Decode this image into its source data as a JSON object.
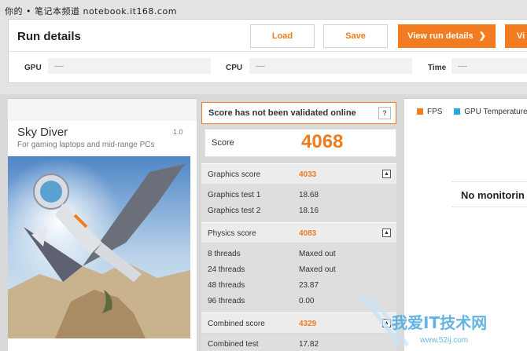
{
  "watermark_top": "你的 • 笔记本频道 notebook.it168.com",
  "run": {
    "title": "Run details",
    "load_label": "Load",
    "save_label": "Save",
    "view_label": "View run details",
    "view_arrow": "❯",
    "view2_label": "Vi",
    "gpu_label": "GPU",
    "gpu_value": "----",
    "cpu_label": "CPU",
    "cpu_value": "----",
    "time_label": "Time",
    "time_value": "----"
  },
  "test": {
    "title": "Sky Diver",
    "version": "1.0",
    "subtitle": "For gaming laptops and mid-range PCs"
  },
  "score": {
    "validation_text": "Score has not been validated online",
    "help": "?",
    "label": "Score",
    "value": "4068",
    "collapse_symbol": "▲",
    "graphics_label": "Graphics score",
    "graphics_value": "4033",
    "graphics_tests": [
      {
        "label": "Graphics test 1",
        "value": "18.68"
      },
      {
        "label": "Graphics test 2",
        "value": "18.16"
      }
    ],
    "physics_label": "Physics score",
    "physics_value": "4083",
    "physics_tests": [
      {
        "label": "8 threads",
        "value": "Maxed out"
      },
      {
        "label": "24 threads",
        "value": "Maxed out"
      },
      {
        "label": "48 threads",
        "value": "23.87"
      },
      {
        "label": "96 threads",
        "value": "0.00"
      }
    ],
    "combined_label": "Combined score",
    "combined_value": "4329",
    "combined_tests": [
      {
        "label": "Combined test",
        "value": "17.82"
      }
    ]
  },
  "monitor": {
    "fps_label": "FPS",
    "gpu_temp_label": "GPU Temperature",
    "no_monitoring": "No monitorin",
    "colors": {
      "fps": "#f47c20",
      "gpu_temp": "#2aa7e0"
    }
  },
  "watermark_bottom": {
    "text": "我爱IT技术网",
    "url": "www.52ij.com"
  }
}
